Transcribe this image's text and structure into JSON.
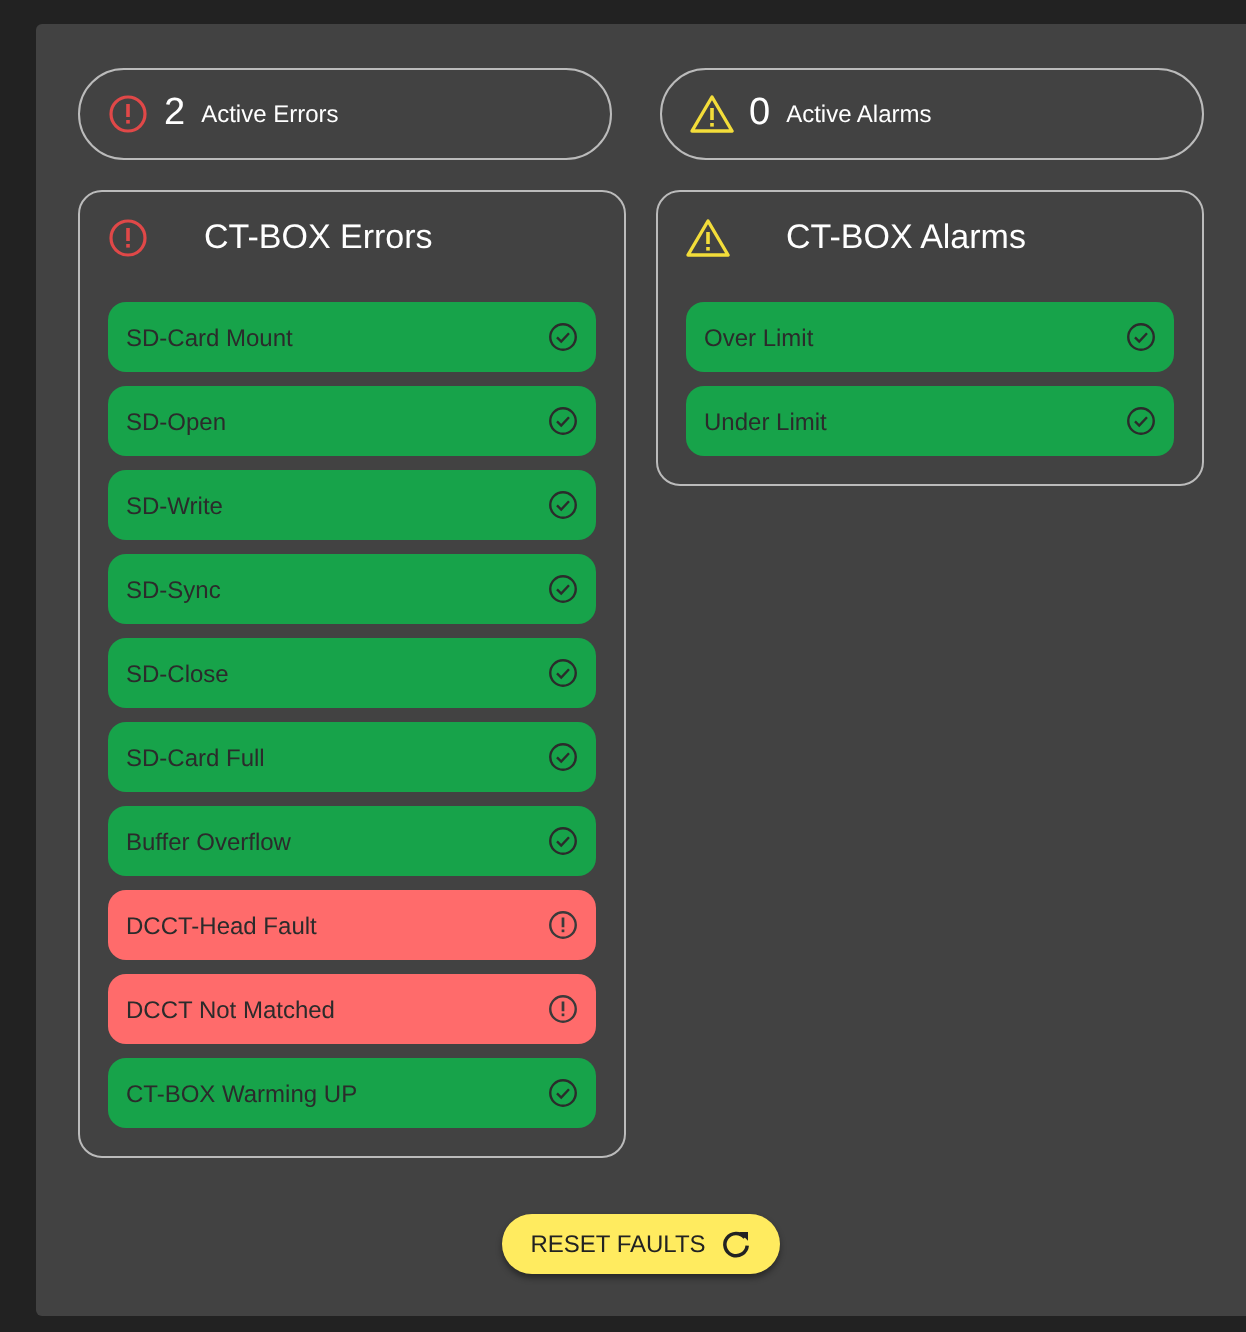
{
  "summary": [
    {
      "kind": "error",
      "count": "2",
      "label": "Active Errors"
    },
    {
      "kind": "alarm",
      "count": "0",
      "label": "Active Alarms"
    }
  ],
  "panels": [
    {
      "kind": "error",
      "title": "CT-BOX Errors",
      "items": [
        {
          "label": "SD-Card Mount",
          "active": false
        },
        {
          "label": "SD-Open",
          "active": false
        },
        {
          "label": "SD-Write",
          "active": false
        },
        {
          "label": "SD-Sync",
          "active": false
        },
        {
          "label": "SD-Close",
          "active": false
        },
        {
          "label": "SD-Card Full",
          "active": false
        },
        {
          "label": "Buffer Overflow",
          "active": false
        },
        {
          "label": "DCCT-Head Fault",
          "active": true
        },
        {
          "label": "DCCT Not Matched",
          "active": true
        },
        {
          "label": "CT-BOX Warming UP",
          "active": false
        }
      ]
    },
    {
      "kind": "alarm",
      "title": "CT-BOX Alarms",
      "items": [
        {
          "label": "Over Limit",
          "active": false
        },
        {
          "label": "Under Limit",
          "active": false
        }
      ]
    }
  ],
  "reset_button": {
    "label": "RESET FAULTS"
  }
}
